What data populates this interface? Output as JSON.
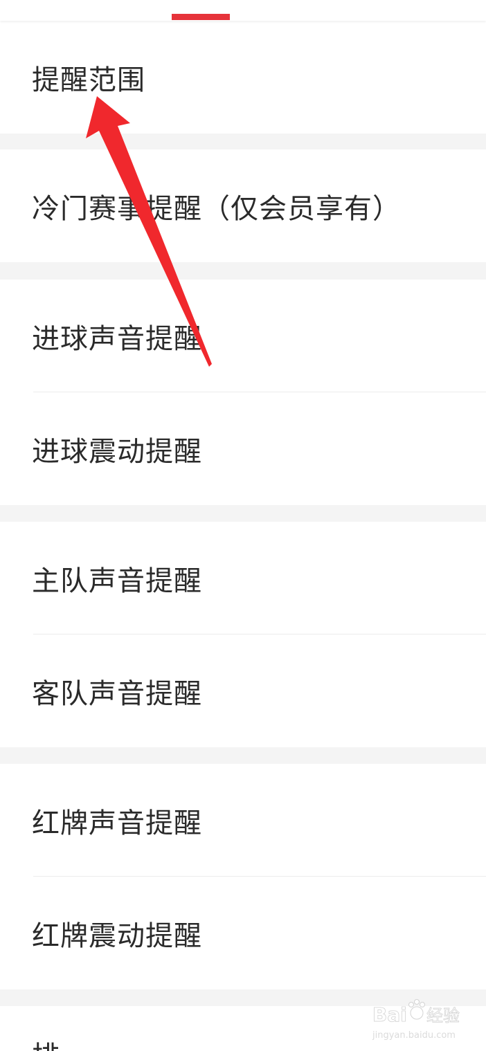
{
  "tabbar": {
    "accent_color": "#e6333a"
  },
  "settings": {
    "range_label": "提醒范围",
    "cold_match_label": "冷门赛事提醒（仅会员享有）",
    "goal_sound_label": "进球声音提醒",
    "goal_vibrate_label": "进球震动提醒",
    "home_sound_label": "主队声音提醒",
    "away_sound_label": "客队声音提醒",
    "red_card_sound_label": "红牌声音提醒",
    "red_card_vibrate_label": "红牌震动提醒",
    "partial_label": "排…"
  },
  "annotation": {
    "arrow_color": "#f0282d"
  },
  "watermark": {
    "brand": "Bai",
    "brand_suffix": "经验",
    "url": "jingyan.baidu.com"
  }
}
